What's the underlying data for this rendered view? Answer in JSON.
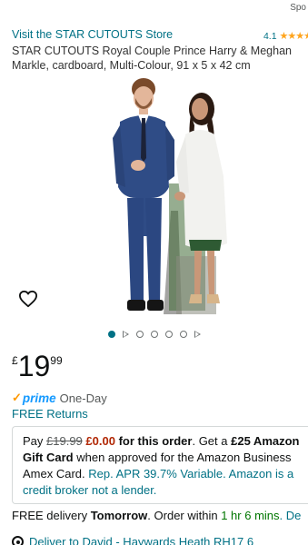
{
  "header": {
    "sponsored_text": "Spo"
  },
  "store": {
    "link_text": "Visit the STAR CUTOUTS Store",
    "rating_value": "4.1",
    "stars_glyphs": "★★★★",
    "stars_fraction": 0.82
  },
  "product": {
    "title": "STAR CUTOUTS Royal Couple Prince Harry & Meghan Markle, cardboard, Multi-Colour, 91 x 5 x 42 cm"
  },
  "gallery": {
    "dot_count": 6,
    "active_index": 0,
    "video_indices": [
      1,
      5
    ]
  },
  "wishlist": {
    "icon": "heart-outline-icon"
  },
  "price": {
    "symbol": "£",
    "whole": "19",
    "fraction": "99"
  },
  "prime": {
    "check": "✓",
    "word": "prime",
    "delivery": "One-Day",
    "returns": "FREE Returns"
  },
  "promo": {
    "pay": "Pay ",
    "original": "£19.99",
    "space": " ",
    "new_price": "£0.00",
    "for_order": " for this order",
    "get_a": ". Get a ",
    "gift_amount": "£25 Amazon Gift Card",
    "approved": " when approved for the Amazon Business Amex Card. ",
    "apr_text": "Rep. APR 39.7% Variable. Amazon is a credit broker not a lender."
  },
  "delivery": {
    "prefix": "FREE delivery ",
    "day": "Tomorrow",
    "middle": ". Order within ",
    "countdown": "1 hr 6 mins",
    "suffix": ". De"
  },
  "deliver_to": {
    "text": "Deliver to David - Haywards Heath RH17 6"
  },
  "colors": {
    "link": "#007185",
    "price_red": "#b12704",
    "prime_blue": "#1399ff",
    "prime_orange": "#ff9900",
    "star": "#ffa41c",
    "green": "#007600"
  }
}
